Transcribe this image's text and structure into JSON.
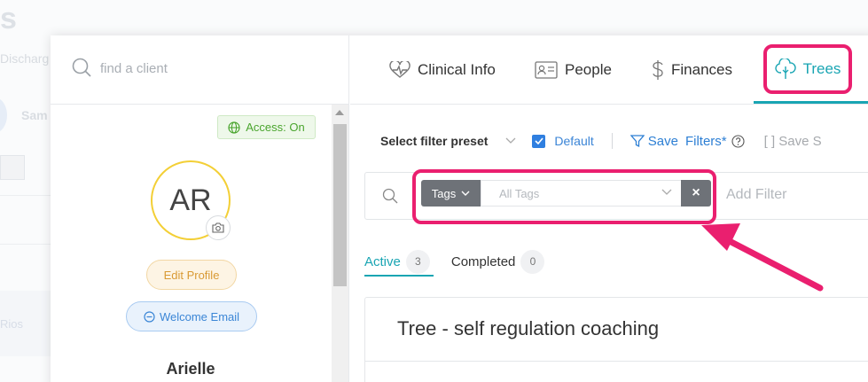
{
  "background": {
    "title": "s",
    "subtitle": "Discharg",
    "name": "Sam",
    "row_text": "Rios"
  },
  "client_search": {
    "placeholder": "find a client"
  },
  "profile": {
    "access_badge": "Access: On",
    "initials": "AR",
    "edit_profile": "Edit Profile",
    "welcome_email": "Welcome Email",
    "name": "Arielle"
  },
  "tabs": [
    {
      "label": "Clinical Info",
      "icon": "heartbeat-icon"
    },
    {
      "label": "People",
      "icon": "id-card-icon"
    },
    {
      "label": "Finances",
      "icon": "dollar-icon"
    },
    {
      "label": "Trees",
      "icon": "tree-icon",
      "active": true
    }
  ],
  "filter_bar": {
    "preset_label": "Select filter preset",
    "default_label": "Default",
    "default_checked": true,
    "save_label": "Save",
    "filters_label": "Filters*",
    "save_disabled": "[ ] Save  S"
  },
  "tag_filter": {
    "tags_label": "Tags",
    "placeholder": "All Tags",
    "clear": "×",
    "add_filter": "Add Filter"
  },
  "status_tabs": [
    {
      "label": "Active",
      "count": "3",
      "active": true
    },
    {
      "label": "Completed",
      "count": "0",
      "active": false
    }
  ],
  "trees": [
    {
      "title": "Tree - self regulation coaching"
    }
  ],
  "colors": {
    "accent": "#19a5b3",
    "highlight": "#ea1f6f",
    "link_blue": "#2d7fd4",
    "access_green": "#4aa52e"
  }
}
